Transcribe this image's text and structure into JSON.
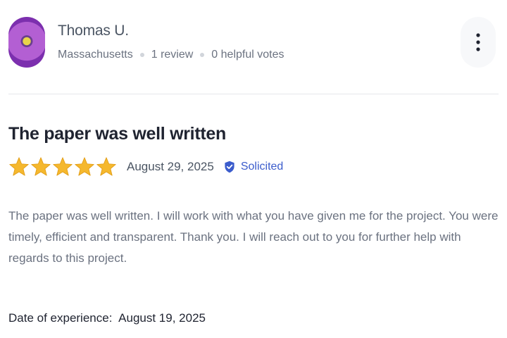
{
  "user": {
    "name": "Thomas U.",
    "location": "Massachusetts",
    "review_count": "1 review",
    "helpful_votes": "0 helpful votes"
  },
  "review": {
    "title": "The paper was well written",
    "rating": 5,
    "rating_max": 5,
    "date": "August 29, 2025",
    "badge": "Solicited",
    "body": "The paper was well written. I will work with what you have given me for the project. You were timely, efficient and transparent. Thank you. I will reach out to you for further help with regards to this project.",
    "experience_label": "Date of experience:",
    "experience_date": "August 19, 2025"
  },
  "icons": {
    "more": "more-vertical-icon",
    "star": "star-icon",
    "badge": "shield-check-icon"
  },
  "colors": {
    "star": "#f5b82e",
    "badge": "#3b5ccc",
    "title": "#1f2330",
    "muted": "#6b7280"
  }
}
